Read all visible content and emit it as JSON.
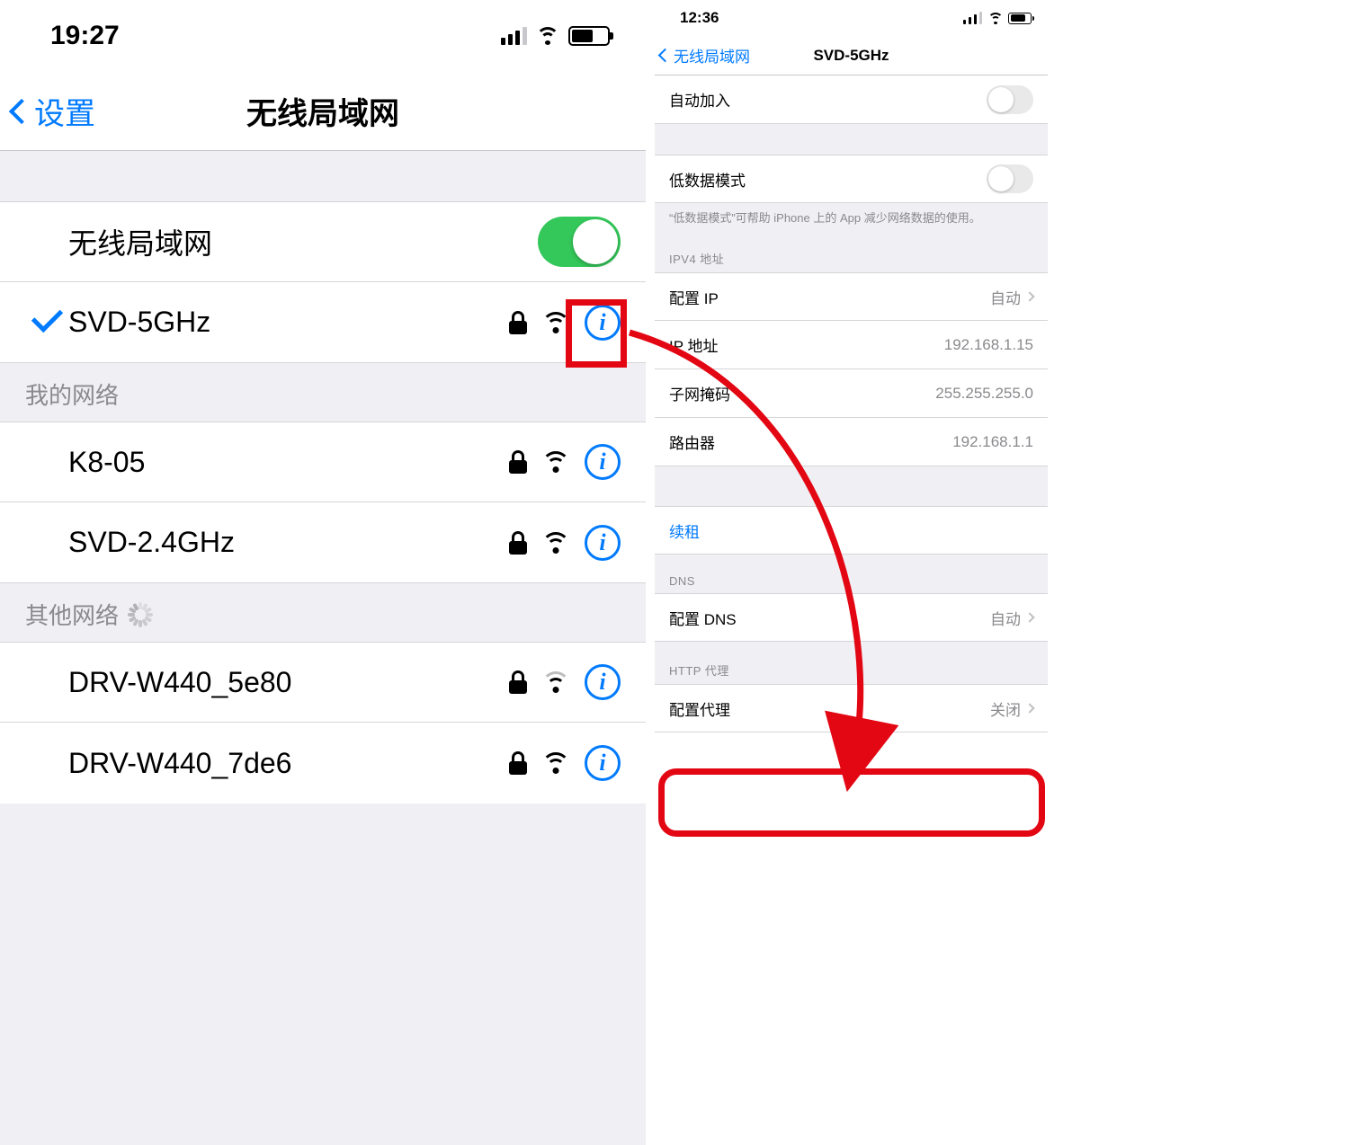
{
  "left": {
    "status_time": "19:27",
    "nav_back": "设置",
    "nav_title": "无线局域网",
    "toggle_label": "无线局域网",
    "connected": {
      "name": "SVD-5GHz"
    },
    "my_networks_header": "我的网络",
    "my_networks": [
      {
        "name": "K8-05"
      },
      {
        "name": "SVD-2.4GHz"
      }
    ],
    "other_networks_header": "其他网络",
    "other_networks": [
      {
        "name": "DRV-W440_5e80",
        "weak": true
      },
      {
        "name": "DRV-W440_7de6",
        "weak": false
      }
    ]
  },
  "right": {
    "status_time": "12:36",
    "nav_back": "无线局域网",
    "nav_title": "SVD-5GHz",
    "auto_join_label": "自动加入",
    "low_data_label": "低数据模式",
    "low_data_note": "“低数据模式”可帮助 iPhone 上的 App 减少网络数据的使用。",
    "ipv4_header": "IPV4 地址",
    "ipv4": {
      "config_ip_label": "配置 IP",
      "config_ip_value": "自动",
      "ip_label": "IP 地址",
      "ip_value": "192.168.1.15",
      "mask_label": "子网掩码",
      "mask_value": "255.255.255.0",
      "router_label": "路由器",
      "router_value": "192.168.1.1"
    },
    "renew_label": "续租",
    "dns_header": "DNS",
    "dns": {
      "config_label": "配置 DNS",
      "config_value": "自动"
    },
    "proxy_header": "HTTP 代理",
    "proxy": {
      "config_label": "配置代理",
      "config_value": "关闭"
    }
  }
}
